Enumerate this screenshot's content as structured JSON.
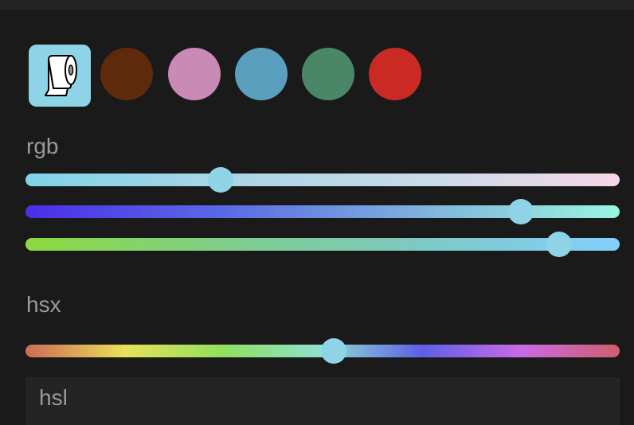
{
  "theme": {
    "background": "#1a1a1a",
    "thumb_color": "#8fd3e6"
  },
  "swatches": {
    "selected": {
      "icon": "toilet-paper-icon",
      "color": "#8fd3e6"
    },
    "items": [
      {
        "color": "#5f2a0c"
      },
      {
        "color": "#c98bb5"
      },
      {
        "color": "#5a9fbe"
      },
      {
        "color": "#4a8668"
      },
      {
        "color": "#c92a24"
      }
    ]
  },
  "rgb": {
    "label": "rgb",
    "sliders": [
      {
        "channel": "r",
        "value_fraction": 0.329,
        "gradient": [
          "#7fd3e8",
          "#a9d6e6",
          "#c8dbe8",
          "#f6d6e8"
        ]
      },
      {
        "channel": "g",
        "value_fraction": 0.834,
        "gradient": [
          "#4b2ee8",
          "#5a6ae6",
          "#7fb2dc",
          "#9af5e0"
        ]
      },
      {
        "channel": "b",
        "value_fraction": 0.898,
        "gradient": [
          "#8ed940",
          "#7fcf8a",
          "#7dc9c4",
          "#84cfff"
        ]
      }
    ]
  },
  "hsx": {
    "label": "hsx",
    "slider": {
      "channel": "h",
      "value_fraction": 0.519,
      "gradient": [
        "#cf6a55",
        "#e8e05a",
        "#8fe05e",
        "#8fe0d0",
        "#5e5fe6",
        "#c96ae6",
        "#cf5e6a"
      ]
    }
  },
  "mode": {
    "value": "hsl"
  }
}
